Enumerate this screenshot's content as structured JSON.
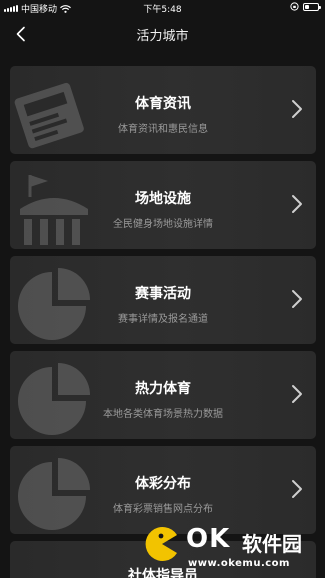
{
  "status": {
    "carrier": "中国移动",
    "time": "下午5:48",
    "battery_fraction": 0.3
  },
  "nav": {
    "back_icon": "chevron-left-icon",
    "title": "活力城市"
  },
  "cards": [
    {
      "title": "体育资讯",
      "subtitle": "体育资讯和惠民信息",
      "bg_icon": "newspaper-icon"
    },
    {
      "title": "场地设施",
      "subtitle": "全民健身场地设施详情",
      "bg_icon": "stadium-icon"
    },
    {
      "title": "赛事活动",
      "subtitle": "赛事详情及报名通道",
      "bg_icon": "pie-chart-icon"
    },
    {
      "title": "热力体育",
      "subtitle": "本地各类体育场景热力数据",
      "bg_icon": "pie-chart-icon"
    },
    {
      "title": "体彩分布",
      "subtitle": "体育彩票销售网点分布",
      "bg_icon": "pie-chart-icon"
    },
    {
      "title": "社体指导员"
    }
  ],
  "watermark": {
    "brand": "OK",
    "name": "软件园",
    "url": "www.okemu.com"
  }
}
